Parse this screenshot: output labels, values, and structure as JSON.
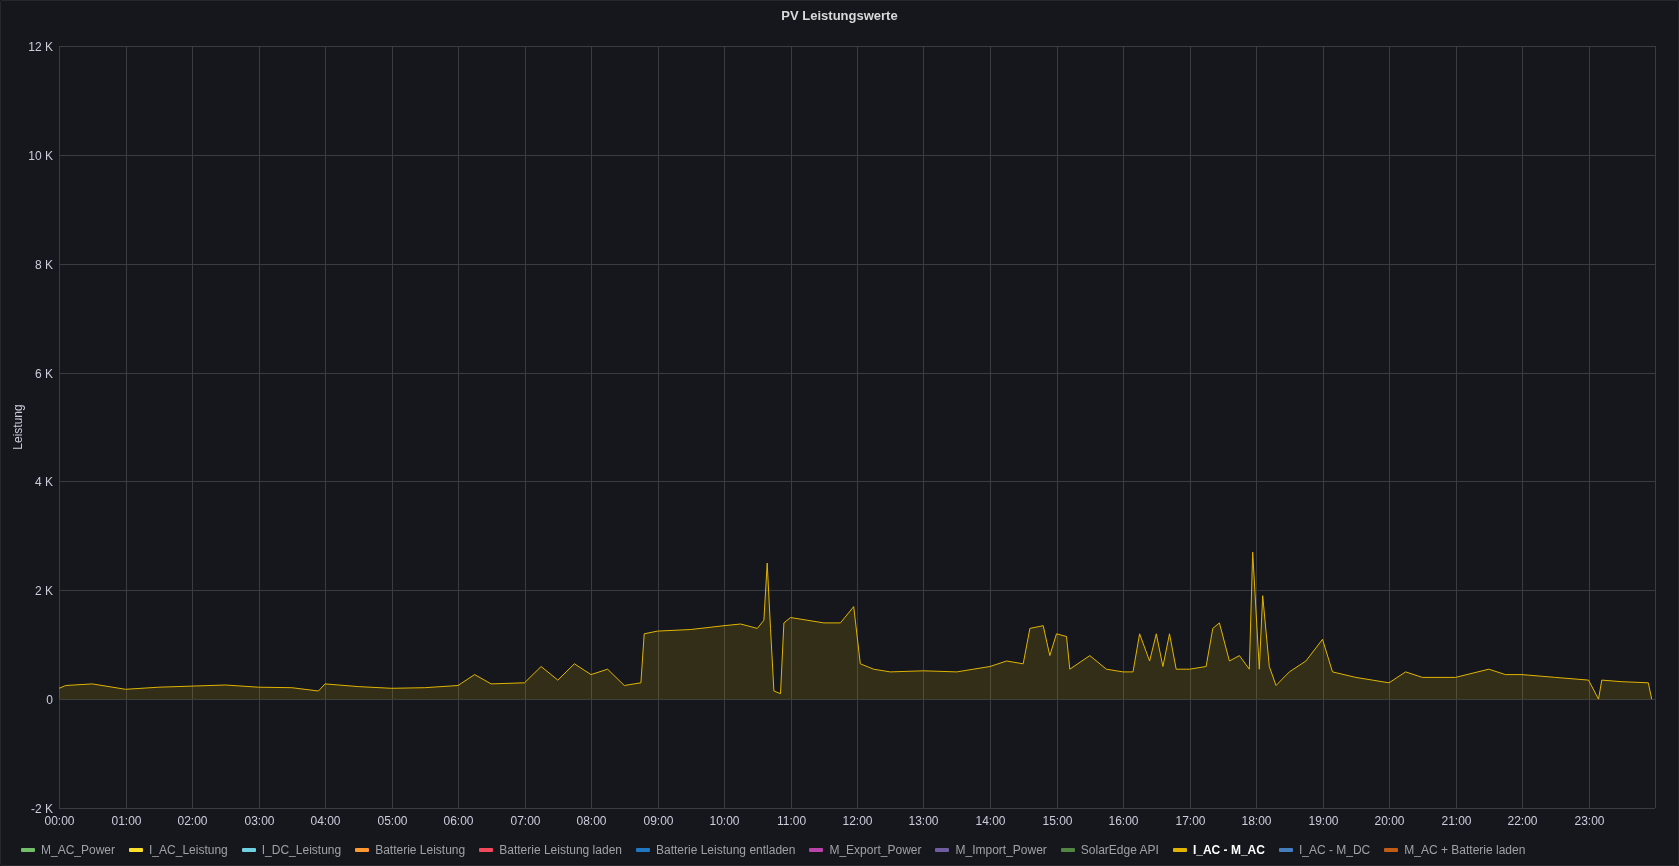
{
  "chart": {
    "chart_data": {
      "type": "area",
      "title": "PV Leistungswerte",
      "grid": true,
      "ylabel": "Leistung",
      "xlim": [
        0,
        24
      ],
      "ylim": [
        -2000,
        12000
      ],
      "yticks": [
        {
          "value": -2000,
          "label": "-2 K"
        },
        {
          "value": 0,
          "label": "0"
        },
        {
          "value": 2000,
          "label": "2 K"
        },
        {
          "value": 4000,
          "label": "4 K"
        },
        {
          "value": 6000,
          "label": "6 K"
        },
        {
          "value": 8000,
          "label": "8 K"
        },
        {
          "value": 10000,
          "label": "10 K"
        },
        {
          "value": 12000,
          "label": "12 K"
        }
      ],
      "xticks": [
        {
          "value": 0,
          "label": "00:00"
        },
        {
          "value": 1,
          "label": "01:00"
        },
        {
          "value": 2,
          "label": "02:00"
        },
        {
          "value": 3,
          "label": "03:00"
        },
        {
          "value": 4,
          "label": "04:00"
        },
        {
          "value": 5,
          "label": "05:00"
        },
        {
          "value": 6,
          "label": "06:00"
        },
        {
          "value": 7,
          "label": "07:00"
        },
        {
          "value": 8,
          "label": "08:00"
        },
        {
          "value": 9,
          "label": "09:00"
        },
        {
          "value": 10,
          "label": "10:00"
        },
        {
          "value": 11,
          "label": "11:00"
        },
        {
          "value": 12,
          "label": "12:00"
        },
        {
          "value": 13,
          "label": "13:00"
        },
        {
          "value": 14,
          "label": "14:00"
        },
        {
          "value": 15,
          "label": "15:00"
        },
        {
          "value": 16,
          "label": "16:00"
        },
        {
          "value": 17,
          "label": "17:00"
        },
        {
          "value": 18,
          "label": "18:00"
        },
        {
          "value": 19,
          "label": "19:00"
        },
        {
          "value": 20,
          "label": "20:00"
        },
        {
          "value": 21,
          "label": "21:00"
        },
        {
          "value": 22,
          "label": "22:00"
        },
        {
          "value": 23,
          "label": "23:00"
        }
      ],
      "x": [
        0,
        0.1,
        0.5,
        1,
        1.5,
        2,
        2.5,
        3,
        3.5,
        3.9,
        4,
        4.5,
        5,
        5.5,
        6,
        6.25,
        6.5,
        7,
        7.25,
        7.5,
        7.75,
        8,
        8.25,
        8.5,
        8.75,
        8.8,
        9,
        9.5,
        10,
        10.25,
        10.5,
        10.6,
        10.65,
        10.7,
        10.75,
        10.85,
        10.9,
        11,
        11.25,
        11.5,
        11.75,
        11.95,
        12.05,
        12.25,
        12.5,
        13,
        13.5,
        13.75,
        14,
        14.25,
        14.5,
        14.6,
        14.8,
        14.9,
        15,
        15.15,
        15.2,
        15.5,
        15.75,
        16,
        16.15,
        16.25,
        16.4,
        16.5,
        16.6,
        16.7,
        16.8,
        17,
        17.25,
        17.35,
        17.45,
        17.6,
        17.75,
        17.9,
        17.95,
        18.05,
        18.1,
        18.2,
        18.3,
        18.5,
        18.75,
        19,
        19.15,
        19.5,
        19.75,
        20,
        20.25,
        20.5,
        21,
        21.5,
        21.75,
        22,
        22.5,
        23,
        23.15,
        23.2,
        23.5,
        23.9,
        23.95
      ],
      "series": [
        {
          "color": "#e0b400",
          "values": [
            200,
            250,
            280,
            180,
            220,
            240,
            260,
            220,
            210,
            150,
            280,
            230,
            200,
            210,
            250,
            450,
            280,
            300,
            600,
            350,
            650,
            450,
            550,
            250,
            300,
            1200,
            1250,
            1280,
            1350,
            1380,
            1300,
            1450,
            2500,
            1300,
            150,
            100,
            1400,
            1500,
            1450,
            1400,
            1400,
            1700,
            650,
            550,
            500,
            520,
            500,
            550,
            600,
            700,
            650,
            1300,
            1350,
            800,
            1200,
            1150,
            550,
            800,
            550,
            500,
            500,
            1200,
            700,
            1200,
            600,
            1200,
            550,
            550,
            600,
            1300,
            1400,
            700,
            800,
            550,
            2700,
            550,
            1900,
            600,
            250,
            500,
            700,
            1100,
            500,
            400,
            350,
            300,
            500,
            400,
            400,
            550,
            450,
            450,
            400,
            350,
            0,
            350,
            320,
            300,
            0
          ]
        }
      ]
    }
  },
  "legend": [
    {
      "label": "M_AC_Power",
      "color": "#73bf69",
      "selected": false
    },
    {
      "label": "I_AC_Leistung",
      "color": "#fade2a",
      "selected": false
    },
    {
      "label": "I_DC_Leistung",
      "color": "#6ed0e0",
      "selected": false
    },
    {
      "label": "Batterie Leistung",
      "color": "#ff9830",
      "selected": false
    },
    {
      "label": "Batterie Leistung laden",
      "color": "#f2495c",
      "selected": false
    },
    {
      "label": "Batterie Leistung entladen",
      "color": "#1f78c1",
      "selected": false
    },
    {
      "label": "M_Export_Power",
      "color": "#ba43a9",
      "selected": false
    },
    {
      "label": "M_Import_Power",
      "color": "#705da0",
      "selected": false
    },
    {
      "label": "SolarEdge API",
      "color": "#508642",
      "selected": false
    },
    {
      "label": "I_AC - M_AC",
      "color": "#e0b400",
      "selected": true
    },
    {
      "label": "I_AC - M_DC",
      "color": "#447ebc",
      "selected": false
    },
    {
      "label": "M_AC + Batterie laden",
      "color": "#c15c17",
      "selected": false
    }
  ]
}
